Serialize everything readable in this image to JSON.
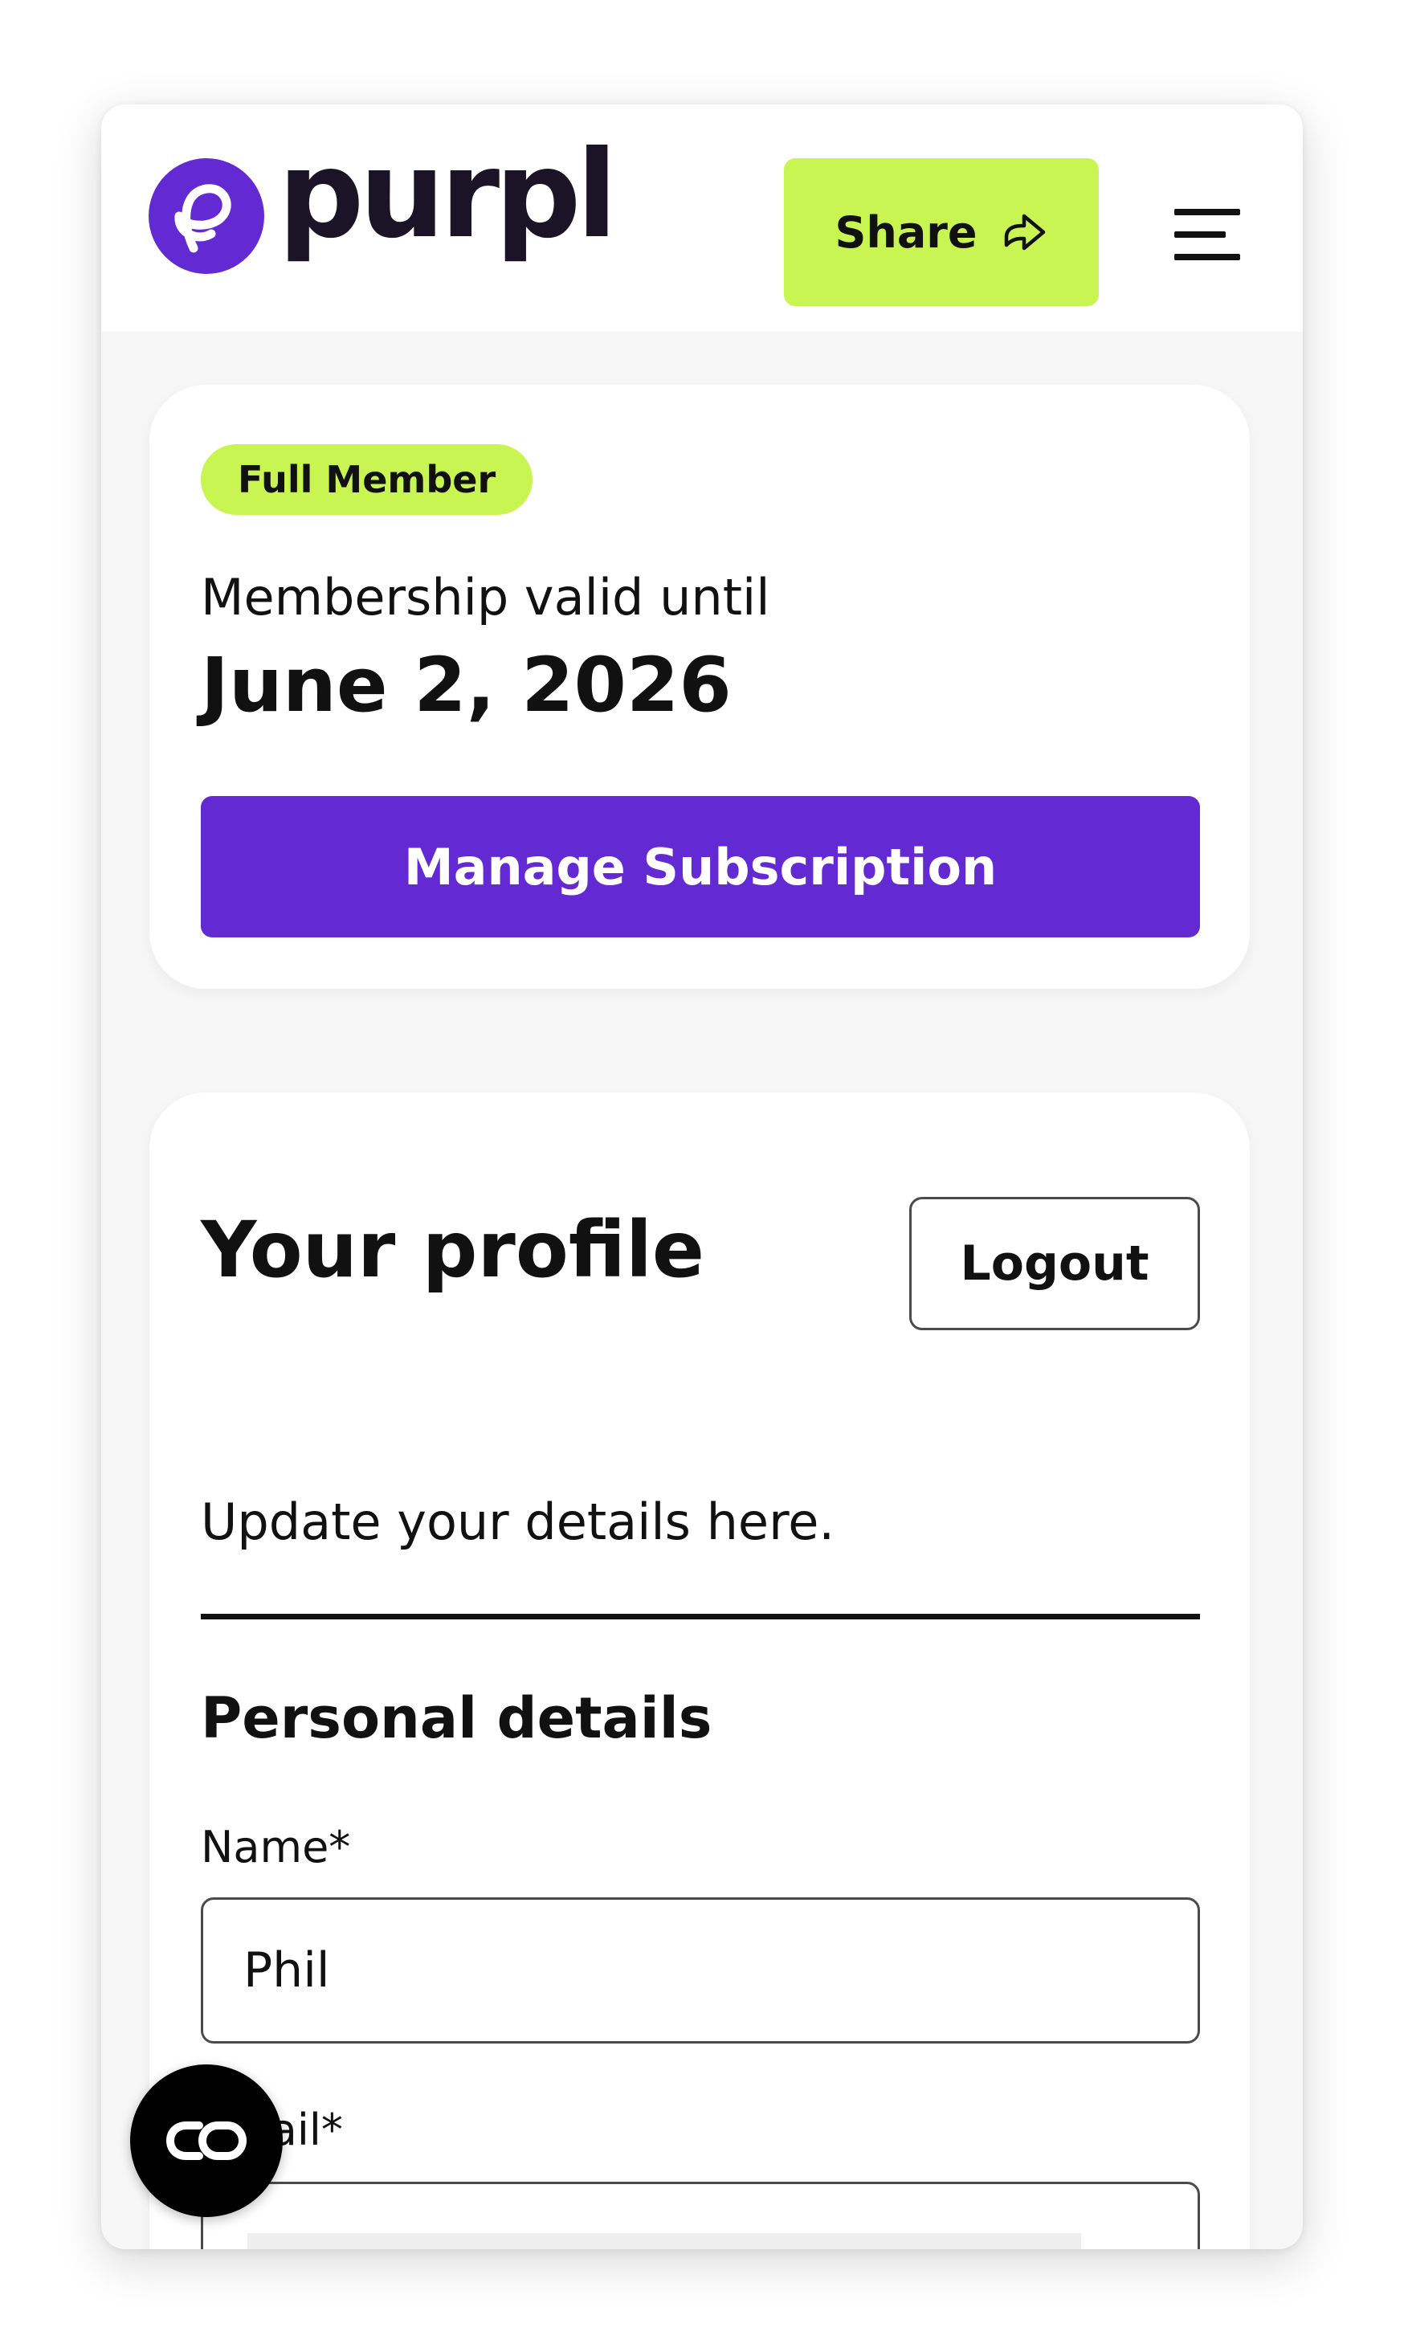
{
  "header": {
    "logo_text": "purpl",
    "share_label": "Share",
    "icons": {
      "logo": "purpl-logo-mark",
      "share": "share-arrow-icon",
      "menu": "hamburger-menu-icon"
    }
  },
  "membership": {
    "badge": "Full Member",
    "valid_label": "Membership valid until",
    "valid_date": "June 2, 2026",
    "manage_label": "Manage Subscription"
  },
  "profile": {
    "title": "Your profile",
    "logout_label": "Logout",
    "subtitle": "Update your details here.",
    "section_title": "Personal details",
    "fields": {
      "name": {
        "label": "Name*",
        "value": "Phil"
      },
      "email": {
        "label": "Email*",
        "value": ""
      }
    }
  },
  "float_button": {
    "icon": "co-badge-icon"
  },
  "colors": {
    "brand_purple": "#632ad4",
    "accent_lime": "#c9f552",
    "page_bg": "#f7f7f7",
    "text_dark": "#111111"
  }
}
